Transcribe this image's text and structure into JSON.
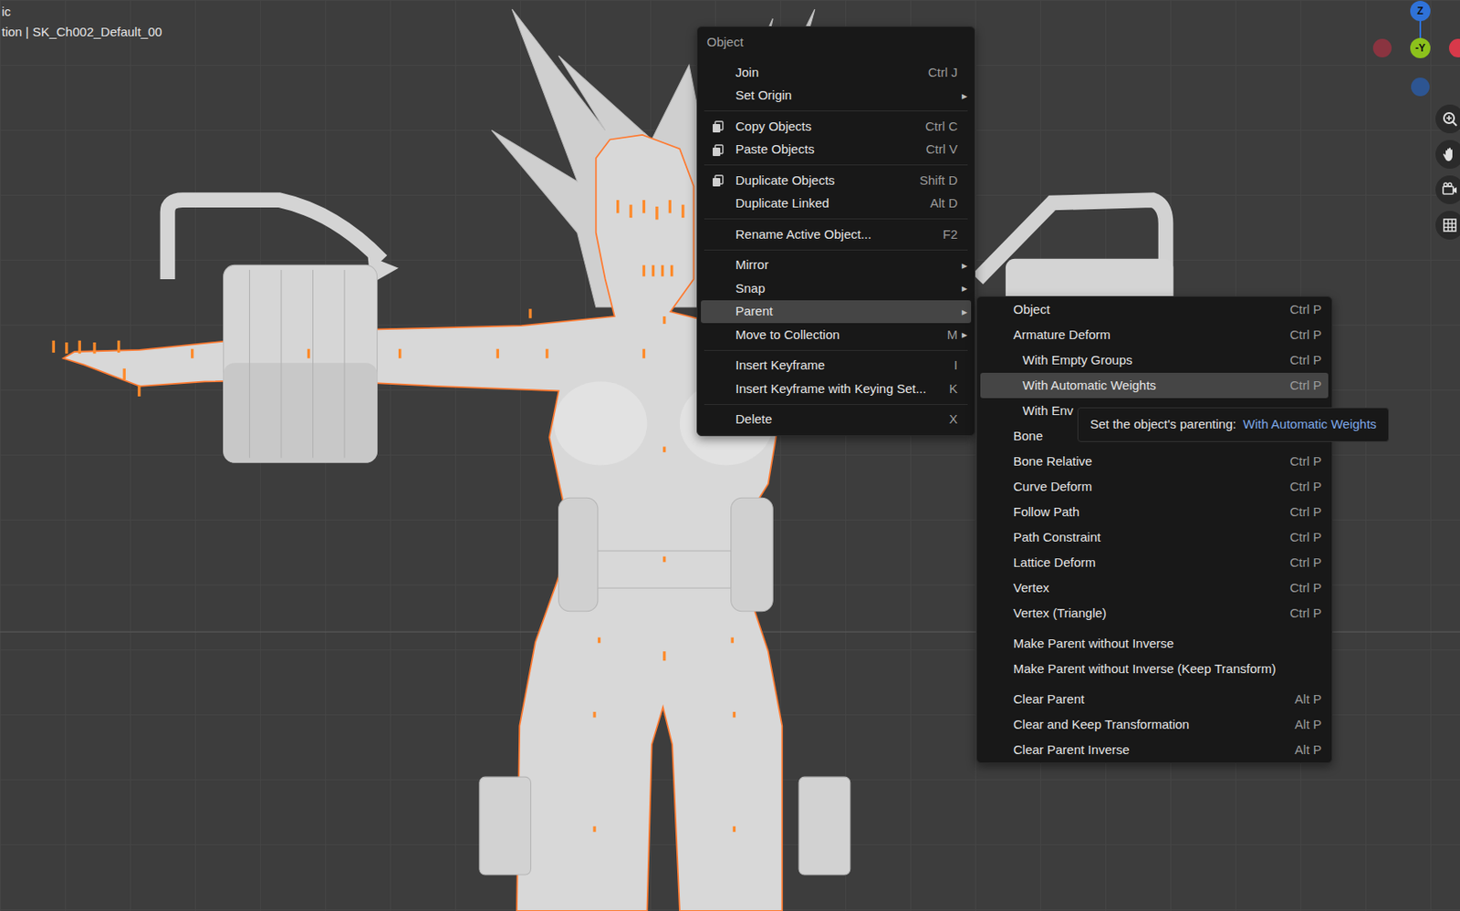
{
  "viewport": {
    "overlay_text": [
      "ic",
      "tion | SK_Ch002_Default_00"
    ]
  },
  "gizmo": [
    {
      "label": "Z",
      "color": "#2f72d8"
    },
    {
      "label": "",
      "color": "#8a3440"
    },
    {
      "label": "-Y",
      "color": "#8cc11c"
    },
    {
      "label": "",
      "color": "#d8394a"
    },
    {
      "label": "",
      "color": "#2d5592"
    }
  ],
  "context_menu": {
    "title": "Object",
    "items": [
      {
        "kind": "item",
        "label": "Join",
        "shortcut": "Ctrl J",
        "arrow": "",
        "icon": false,
        "selected": false
      },
      {
        "kind": "item",
        "label": "Set Origin",
        "shortcut": "",
        "arrow": "▸",
        "icon": false,
        "selected": false
      },
      {
        "kind": "separator"
      },
      {
        "kind": "item",
        "label": "Copy Objects",
        "shortcut": "Ctrl C",
        "arrow": "",
        "icon": true,
        "selected": false
      },
      {
        "kind": "item",
        "label": "Paste Objects",
        "shortcut": "Ctrl V",
        "arrow": "",
        "icon": true,
        "selected": false
      },
      {
        "kind": "separator"
      },
      {
        "kind": "item",
        "label": "Duplicate Objects",
        "shortcut": "Shift D",
        "arrow": "",
        "icon": true,
        "selected": false
      },
      {
        "kind": "item",
        "label": "Duplicate Linked",
        "shortcut": "Alt D",
        "arrow": "",
        "icon": false,
        "selected": false
      },
      {
        "kind": "separator"
      },
      {
        "kind": "item",
        "label": "Rename Active Object...",
        "shortcut": "F2",
        "arrow": "",
        "icon": false,
        "selected": false
      },
      {
        "kind": "separator"
      },
      {
        "kind": "item",
        "label": "Mirror",
        "shortcut": "",
        "arrow": "▸",
        "icon": false,
        "selected": false
      },
      {
        "kind": "item",
        "label": "Snap",
        "shortcut": "",
        "arrow": "▸",
        "icon": false,
        "selected": false
      },
      {
        "kind": "item",
        "label": "Parent",
        "shortcut": "",
        "arrow": "▸",
        "icon": false,
        "selected": true
      },
      {
        "kind": "item",
        "label": "Move to Collection",
        "shortcut": "M",
        "arrow": "▸",
        "icon": false,
        "selected": false
      },
      {
        "kind": "separator"
      },
      {
        "kind": "item",
        "label": "Insert Keyframe",
        "shortcut": "I",
        "arrow": "",
        "icon": false,
        "selected": false
      },
      {
        "kind": "item",
        "label": "Insert Keyframe with Keying Set...",
        "shortcut": "K",
        "arrow": "",
        "icon": false,
        "selected": false
      },
      {
        "kind": "separator"
      },
      {
        "kind": "item",
        "label": "Delete",
        "shortcut": "X",
        "arrow": "",
        "icon": false,
        "selected": false
      }
    ]
  },
  "submenu": {
    "items": [
      {
        "kind": "item",
        "label": "Object",
        "shortcut": "Ctrl P",
        "indent": false,
        "selected": false
      },
      {
        "kind": "item",
        "label": "Armature Deform",
        "shortcut": "Ctrl P",
        "indent": false,
        "selected": false
      },
      {
        "kind": "item",
        "label": "With Empty Groups",
        "shortcut": "Ctrl P",
        "indent": true,
        "selected": false
      },
      {
        "kind": "item",
        "label": "With Automatic Weights",
        "shortcut": "Ctrl P",
        "indent": true,
        "selected": true
      },
      {
        "kind": "item",
        "label": "With Env",
        "shortcut": "",
        "indent": true,
        "selected": false
      },
      {
        "kind": "item",
        "label": "Bone",
        "shortcut": "",
        "indent": false,
        "selected": false
      },
      {
        "kind": "item",
        "label": "Bone Relative",
        "shortcut": "Ctrl P",
        "indent": false,
        "selected": false
      },
      {
        "kind": "item",
        "label": "Curve Deform",
        "shortcut": "Ctrl P",
        "indent": false,
        "selected": false
      },
      {
        "kind": "item",
        "label": "Follow Path",
        "shortcut": "Ctrl P",
        "indent": false,
        "selected": false
      },
      {
        "kind": "item",
        "label": "Path Constraint",
        "shortcut": "Ctrl P",
        "indent": false,
        "selected": false
      },
      {
        "kind": "item",
        "label": "Lattice Deform",
        "shortcut": "Ctrl P",
        "indent": false,
        "selected": false
      },
      {
        "kind": "item",
        "label": "Vertex",
        "shortcut": "Ctrl P",
        "indent": false,
        "selected": false
      },
      {
        "kind": "item",
        "label": "Vertex (Triangle)",
        "shortcut": "Ctrl P",
        "indent": false,
        "selected": false
      },
      {
        "kind": "separator"
      },
      {
        "kind": "item",
        "label": "Make Parent without Inverse",
        "shortcut": "",
        "indent": false,
        "selected": false
      },
      {
        "kind": "item",
        "label": "Make Parent without Inverse (Keep Transform)",
        "shortcut": "",
        "indent": false,
        "selected": false
      },
      {
        "kind": "separator"
      },
      {
        "kind": "item",
        "label": "Clear Parent",
        "shortcut": "Alt P",
        "indent": false,
        "selected": false
      },
      {
        "kind": "item",
        "label": "Clear and Keep Transformation",
        "shortcut": "Alt P",
        "indent": false,
        "selected": false
      },
      {
        "kind": "item",
        "label": "Clear Parent Inverse",
        "shortcut": "Alt P",
        "indent": false,
        "selected": false
      }
    ]
  },
  "tooltip": {
    "label": "Set the object's parenting:",
    "value": "With Automatic Weights"
  }
}
